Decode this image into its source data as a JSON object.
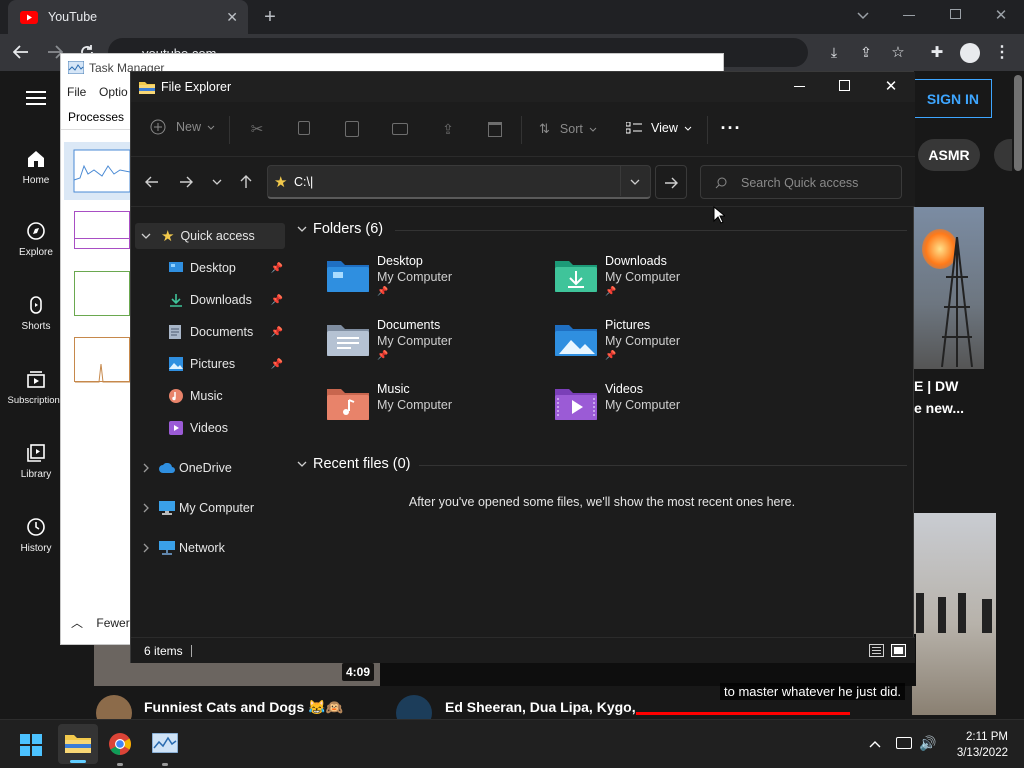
{
  "browser": {
    "tab_title": "YouTube",
    "address": "youtube.com"
  },
  "youtube": {
    "nav": [
      {
        "label": "Home"
      },
      {
        "label": "Explore"
      },
      {
        "label": "Shorts"
      },
      {
        "label": "Subscriptions"
      },
      {
        "label": "Library"
      },
      {
        "label": "History"
      }
    ],
    "sign_in": "SIGN IN",
    "chip": "ASMR",
    "video_title_partial_1": "E | DW",
    "video_title_partial_2": "e new...",
    "duration": "4:09",
    "card1_title": "Funniest Cats and Dogs 😹🙉",
    "card2_title": "Ed Sheeran, Dua Lipa, Kygo, Av",
    "caption": "to master whatever he just did."
  },
  "task_manager": {
    "title": "Task Manager",
    "menu": [
      "File",
      "Optio"
    ],
    "tab": "Processes",
    "fewer": "Fewer"
  },
  "explorer": {
    "title": "File Explorer",
    "cmd": {
      "new": "New",
      "sort": "Sort",
      "view": "View"
    },
    "address": "C:\\|",
    "search_placeholder": "Search Quick access",
    "tree": {
      "quick_access": "Quick access",
      "pinned": [
        {
          "label": "Desktop",
          "icon": "desktop-icon",
          "pinned": true
        },
        {
          "label": "Downloads",
          "icon": "downloads-icon",
          "pinned": true
        },
        {
          "label": "Documents",
          "icon": "documents-icon",
          "pinned": true
        },
        {
          "label": "Pictures",
          "icon": "pictures-icon",
          "pinned": true
        },
        {
          "label": "Music",
          "icon": "music-icon",
          "pinned": false
        },
        {
          "label": "Videos",
          "icon": "videos-icon",
          "pinned": false
        }
      ],
      "onedrive": "OneDrive",
      "my_computer": "My Computer",
      "network": "Network"
    },
    "folders_header": "Folders (6)",
    "folders": [
      {
        "name": "Desktop",
        "location": "My Computer"
      },
      {
        "name": "Downloads",
        "location": "My Computer"
      },
      {
        "name": "Documents",
        "location": "My Computer"
      },
      {
        "name": "Pictures",
        "location": "My Computer"
      },
      {
        "name": "Music",
        "location": "My Computer"
      },
      {
        "name": "Videos",
        "location": "My Computer"
      }
    ],
    "recent_header": "Recent files (0)",
    "recent_empty": "After you've opened some files, we'll show the most recent ones here.",
    "status": "6 items"
  },
  "taskbar": {
    "time": "2:11 PM",
    "date": "3/13/2022"
  },
  "colors": {
    "accent": "#3ea6ff",
    "folder_blue": "#2f8fe0",
    "youtube_red": "#ff0000"
  }
}
